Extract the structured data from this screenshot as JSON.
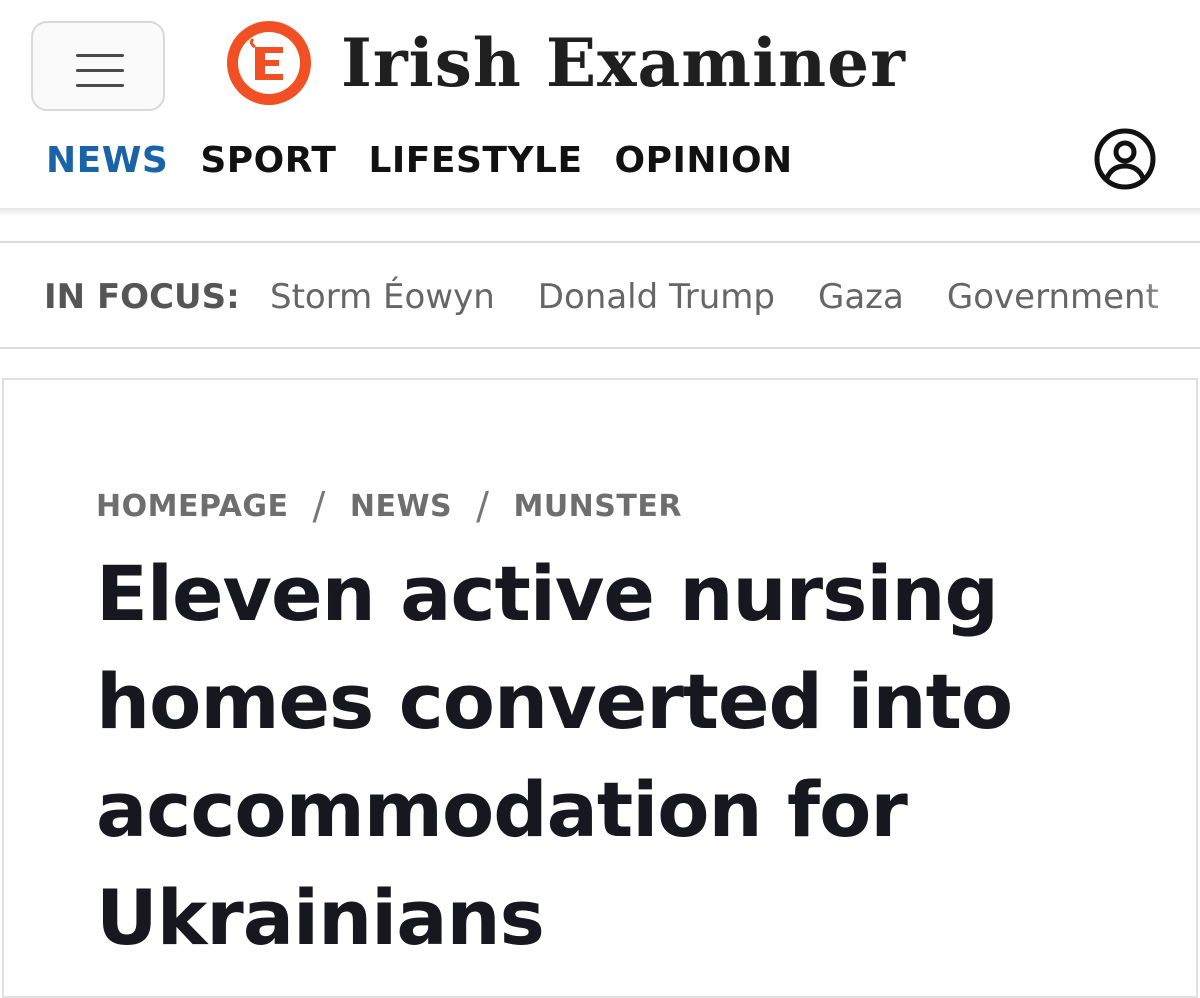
{
  "header": {
    "brand": "Irish Examiner",
    "logo_icon": "ie-monogram-logo",
    "brand_color": "#f05023",
    "menu_icon": "hamburger-menu-icon",
    "user_icon": "user-account-icon"
  },
  "nav": {
    "items": [
      "NEWS",
      "SPORT",
      "LIFESTYLE",
      "OPINION"
    ],
    "active": "NEWS",
    "active_color": "#1a63a6"
  },
  "in_focus": {
    "label": "IN FOCUS:",
    "items": [
      "Storm Éowyn",
      "Donald Trump",
      "Gaza",
      "Government"
    ]
  },
  "article": {
    "breadcrumb": [
      "HOMEPAGE",
      "NEWS",
      "MUNSTER"
    ],
    "separator": "/",
    "headline": "Eleven active nursing homes converted into accommodation for Ukrainians"
  }
}
